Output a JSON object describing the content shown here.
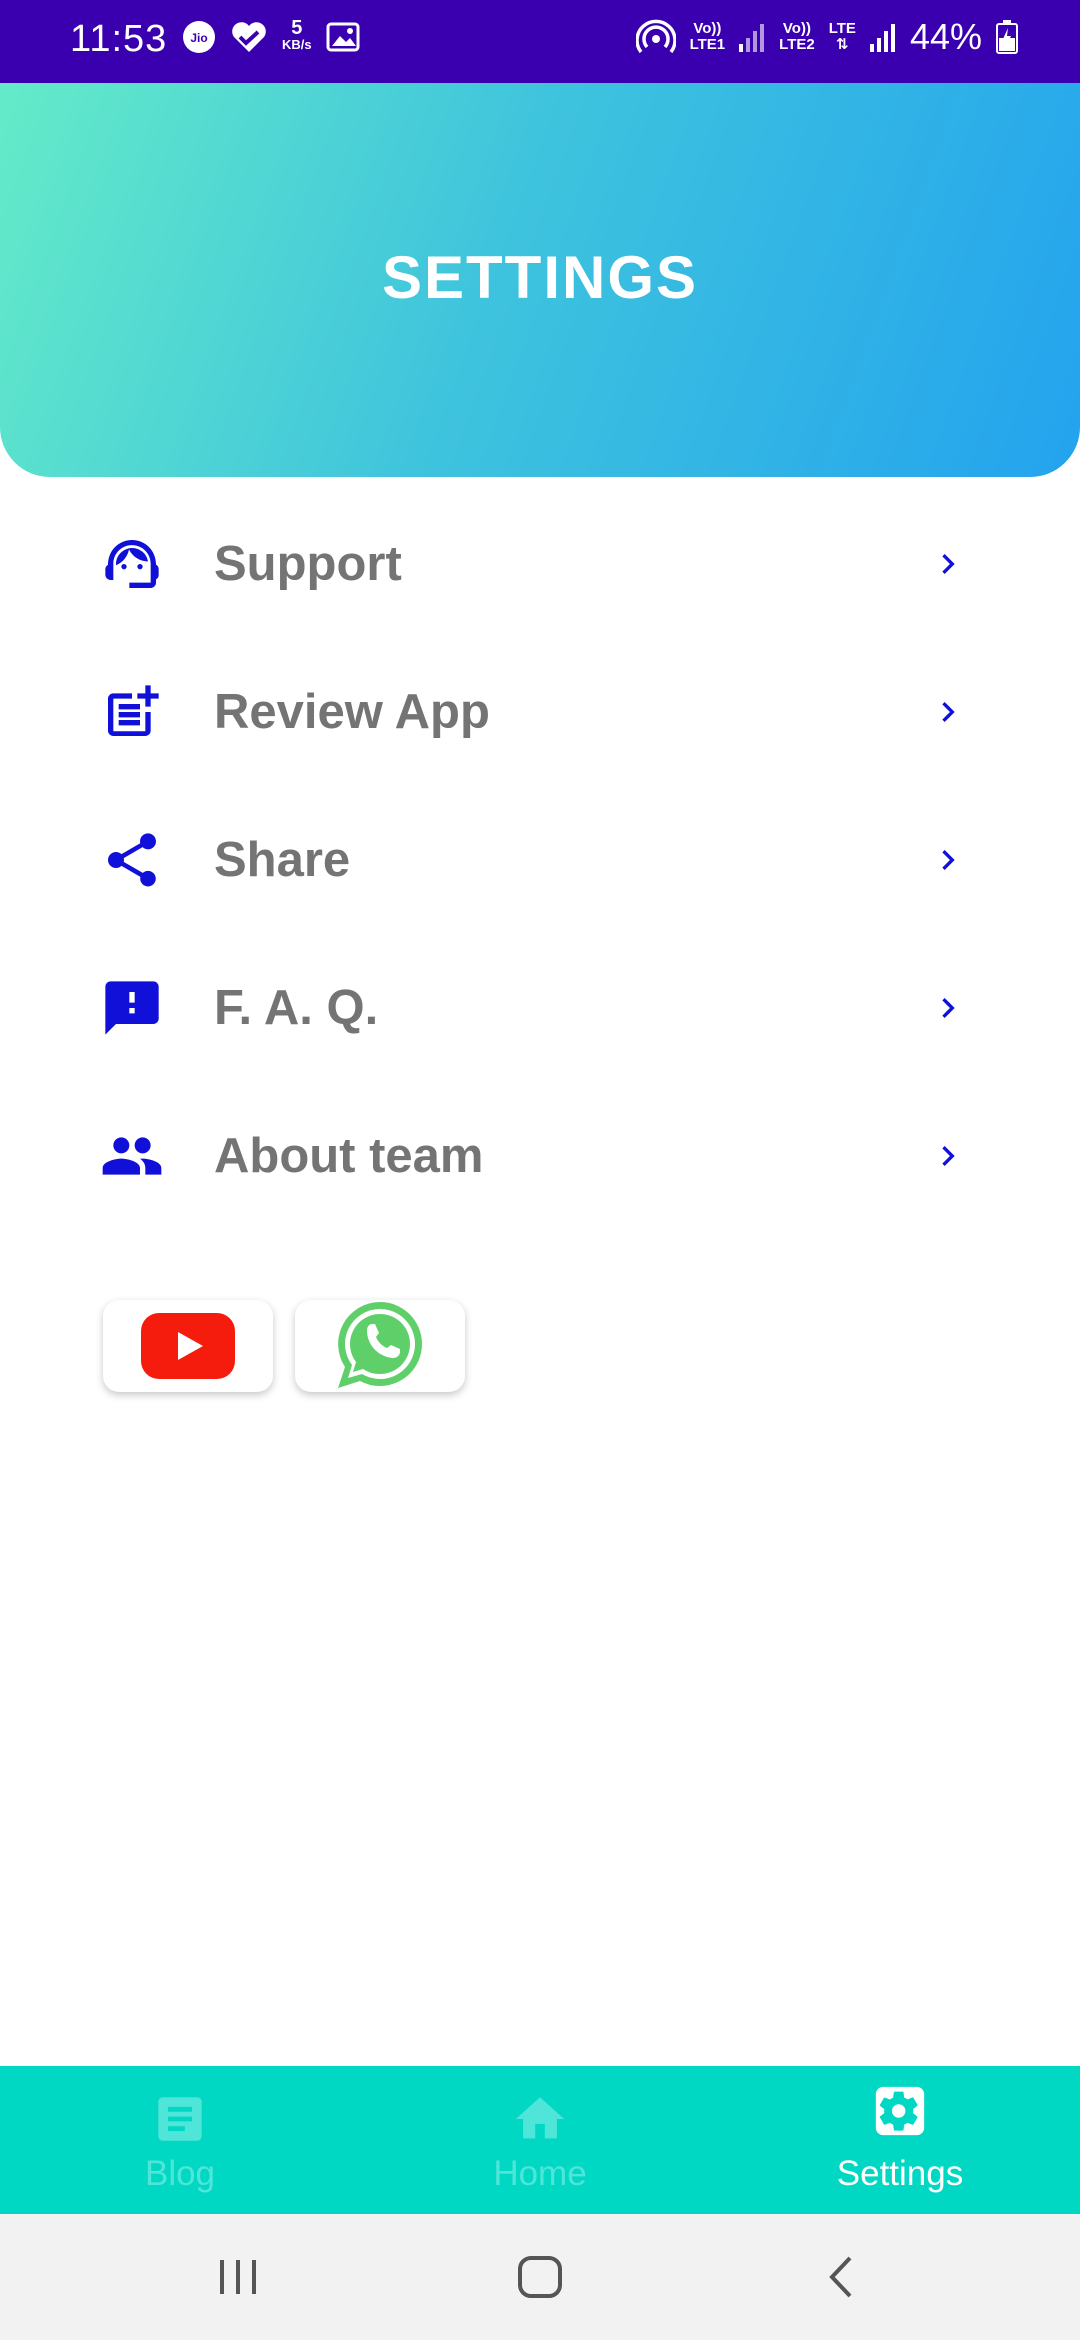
{
  "status_bar": {
    "time": "11:53",
    "speed_value": "5",
    "speed_unit": "KB/s",
    "jio_label": "Jio",
    "sim1_top": "Vo))",
    "sim1_bottom": "LTE1",
    "sim2_top": "Vo))",
    "sim2_bottom": "LTE2",
    "lte_label": "LTE",
    "battery": "44%"
  },
  "header": {
    "title": "SETTINGS"
  },
  "menu": {
    "items": [
      {
        "label": "Support",
        "icon": "support-agent-icon"
      },
      {
        "label": "Review App",
        "icon": "review-post-icon"
      },
      {
        "label": "Share",
        "icon": "share-icon"
      },
      {
        "label": "F. A. Q.",
        "icon": "feedback-icon"
      },
      {
        "label": "About team",
        "icon": "people-icon"
      }
    ]
  },
  "social": [
    {
      "icon": "youtube-icon"
    },
    {
      "icon": "whatsapp-icon"
    }
  ],
  "bottom_nav": {
    "items": [
      {
        "label": "Blog",
        "icon": "article-icon",
        "active": false
      },
      {
        "label": "Home",
        "icon": "home-icon",
        "active": false
      },
      {
        "label": "Settings",
        "icon": "settings-icon",
        "active": true
      }
    ]
  },
  "colors": {
    "status_bar": "#3a00b0",
    "accent_icon": "#1010d8",
    "menu_text": "#747474",
    "bottom_nav": "#00d8c4",
    "header_gradient_start": "#64ebc8",
    "header_gradient_end": "#23a3ee"
  }
}
